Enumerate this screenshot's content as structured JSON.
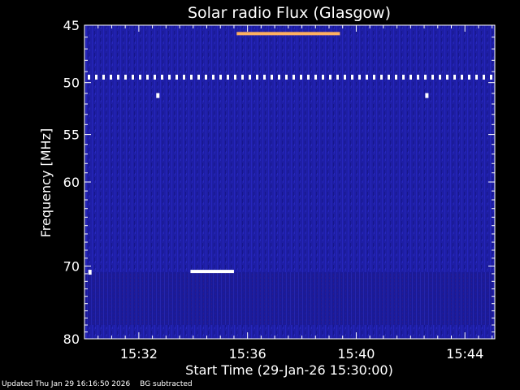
{
  "chart_data": {
    "type": "heatmap",
    "title": "Solar radio Flux (Glasgow)",
    "xlabel": "Start Time (29-Jan-26 15:30:00)",
    "ylabel": "Frequency [MHz]",
    "x_range_minutes": [
      0,
      15.1
    ],
    "x_ticks": [
      {
        "label": "15:32",
        "minutes": 2
      },
      {
        "label": "15:36",
        "minutes": 6
      },
      {
        "label": "15:40",
        "minutes": 10
      },
      {
        "label": "15:44",
        "minutes": 14
      }
    ],
    "y_range_mhz": [
      45,
      80
    ],
    "y_scale": "log",
    "y_ticks": [
      45,
      50,
      55,
      60,
      70,
      80
    ],
    "background_color": "#1d1d9c",
    "features": [
      {
        "kind": "dotted-band",
        "freq_mhz": 49.5,
        "t_start": 0.0,
        "t_end": 15.1,
        "color": "#ffffff"
      },
      {
        "kind": "band",
        "freq_mhz": 45.7,
        "t_start": 5.6,
        "t_end": 9.4,
        "color": "#ffb060"
      },
      {
        "kind": "band",
        "freq_mhz": 70.7,
        "t_start": 3.9,
        "t_end": 5.5,
        "color": "#ffffff"
      },
      {
        "kind": "dot",
        "freq_mhz": 70.8,
        "t": 0.2,
        "color": "#ffffff"
      },
      {
        "kind": "dot",
        "freq_mhz": 51.2,
        "t": 2.7,
        "color": "#ffffff"
      },
      {
        "kind": "dot",
        "freq_mhz": 51.2,
        "t": 12.6,
        "color": "#ffffff"
      }
    ]
  },
  "footer": {
    "updated": "Updated Thu Jan 29 16:16:50 2026",
    "bg_note": "BG subtracted"
  }
}
